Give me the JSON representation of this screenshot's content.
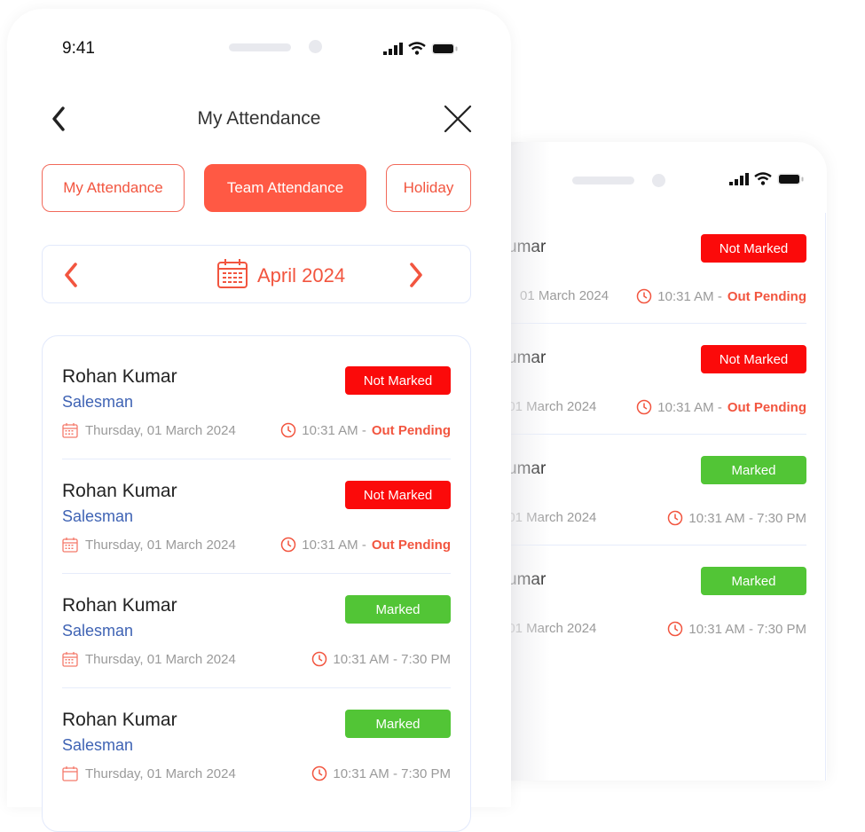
{
  "status_bar": {
    "time": "9:41"
  },
  "header": {
    "title": "My Attendance"
  },
  "tabs": [
    {
      "label": "My Attendance",
      "active": false
    },
    {
      "label": "Team Attendance",
      "active": true
    },
    {
      "label": "Holiday",
      "active": false
    }
  ],
  "month_selector": {
    "label": "April 2024"
  },
  "records": [
    {
      "name": "Rohan Kumar",
      "role": "Salesman",
      "status": "Not Marked",
      "date": "Thursday, 01 March 2024",
      "time_in": "10:31 AM - ",
      "time_out": "Out Pending"
    },
    {
      "name": "Rohan Kumar",
      "role": "Salesman",
      "status": "Not Marked",
      "date": "Thursday, 01 March 2024",
      "time_in": "10:31 AM - ",
      "time_out": "Out Pending"
    },
    {
      "name": "Rohan Kumar",
      "role": "Salesman",
      "status": "Marked",
      "date": "Thursday, 01 March 2024",
      "time_in": "10:31 AM - 7:30 PM",
      "time_out": ""
    },
    {
      "name": "Rohan Kumar",
      "role": "Salesman",
      "status": "Marked",
      "date": "Thursday, 01 March 2024",
      "time_in": "10:31 AM - 7:30 PM",
      "time_out": ""
    }
  ],
  "back_phone": {
    "records": [
      {
        "name": "umar",
        "status": "Not Marked",
        "date": "01 March 2024",
        "time_in": "10:31 AM - ",
        "time_out": "Out Pending"
      },
      {
        "name": "umar",
        "status": "Not Marked",
        "date": ", 01 March 2024",
        "time_in": "10:31 AM - ",
        "time_out": "Out Pending"
      },
      {
        "name": "umar",
        "status": "Marked",
        "date": ", 01 March 2024",
        "time_in": "10:31 AM - 7:30 PM",
        "time_out": ""
      },
      {
        "name": "umar",
        "status": "Marked",
        "date": ", 01 March 2024",
        "time_in": "10:31 AM - 7:30 PM",
        "time_out": ""
      }
    ]
  },
  "colors": {
    "accent": "#ff5944",
    "not_marked": "#fb0a0a",
    "marked": "#52c536",
    "role": "#3f63b4"
  }
}
